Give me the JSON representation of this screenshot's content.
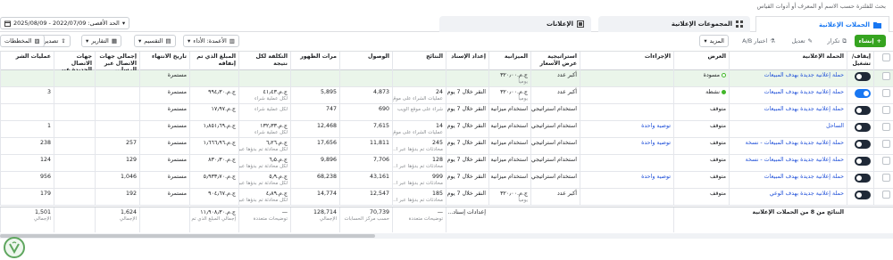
{
  "search": {
    "placeholder": "بحث للفلترة حسب الاسم أو المعرف أو أدوات القياس"
  },
  "tabs": [
    {
      "label": "الحملات الإعلانية",
      "icon": "folder-icon"
    },
    {
      "label": "المجموعات الإعلانية",
      "icon": "grid-icon"
    },
    {
      "label": "الإعلانات",
      "icon": "ad-icon"
    }
  ],
  "date_range": {
    "label": "الحد الأقصى: 2022/07/09 - 2025/08/09"
  },
  "toolbar": {
    "create": "إنشاء",
    "duplicate": "تكرار",
    "edit": "تعديل",
    "ab_test": "اختبار A/B",
    "more": "المزيد",
    "columns": "الأعمدة: الأداء",
    "breakdown": "التقسيم",
    "reports": "التقارير",
    "export": "تصدير",
    "charts": "المخططات"
  },
  "headers": {
    "offon": "إيقاف/تشغيل",
    "campaign": "الحملة الإعلانية",
    "delivery": "العرض",
    "actions": "الإجراءات",
    "bid_strategy": "استراتيجية عرض الأسعار",
    "budget": "الميزانية",
    "attribution": "إعداد الإسناد",
    "results": "النتائج",
    "reach": "الوصول",
    "impressions": "مرات الظهور",
    "cost_per_result": "التكلفة لكل نتيجة",
    "amount_spent": "المبلغ الذي تم إنفاقه",
    "ends": "تاريخ الانتهاء",
    "total_contacts": "إجمالي جهات الاتصال عبر الرسا...",
    "new_contacts": "جهات الاتصال الجديدة عبر الرسا...",
    "purchases": "عمليات الشر"
  },
  "rows": [
    {
      "toggle": "off",
      "name": "حملة إعلانية جديدة بهدف المبيعات",
      "delivery": "مسودة",
      "dot": "outline",
      "action": "",
      "bid": "أكبر عدد",
      "budget": "ج.م.٣٢٠٫٠٠",
      "budget_sub": "يومياً",
      "attribution": "",
      "attribution_sub": "",
      "results": "",
      "results_sub": "",
      "reach": "",
      "impressions": "",
      "cpr": "",
      "cpr_sub": "",
      "spent": "",
      "ends": "مستمرة",
      "total_contacts": "",
      "new_contacts": "",
      "purchases": ""
    },
    {
      "toggle": "on",
      "name": "حملة إعلانية جديدة بهدف المبيعات",
      "delivery": "نشطة",
      "dot": "green",
      "action": "",
      "bid": "أكبر عدد",
      "budget": "ج.م.٣٢٠٫٠٠",
      "budget_sub": "يومياً",
      "attribution": "النقر خلال 7 يوم...",
      "attribution_sub": "",
      "results": "24",
      "results_sub": "عمليات الشراء على موقع",
      "reach": "4,873",
      "impressions": "5,895",
      "cpr": "ج.م.٤١٫٤٣",
      "cpr_sub": "لكل عملية شراء",
      "spent": "ج.م.٩٩٤٫٣٠",
      "ends": "مستمرة",
      "total_contacts": "",
      "new_contacts": "",
      "purchases": "3"
    },
    {
      "toggle": "off",
      "name": "حملة إعلانية جديدة بهدف المبيعات",
      "delivery": "متوقف",
      "dot": "",
      "action": "",
      "bid": "استخدام استراتيجي...",
      "budget": "استخدام ميزانية ال...",
      "budget_sub": "",
      "attribution": "النقر خلال 7 يوم...",
      "attribution_sub": "",
      "results": "",
      "results_sub": "شراء على موقع الويب",
      "reach": "690",
      "impressions": "747",
      "cpr": "",
      "cpr_sub": "لكل عملية شراء",
      "spent": "ج.م.١٧٫٩٧",
      "ends": "مستمرة",
      "total_contacts": "",
      "new_contacts": "",
      "purchases": ""
    },
    {
      "toggle": "off",
      "name": "الساحل",
      "delivery": "متوقف",
      "dot": "",
      "action": "توصية واحدة",
      "bid": "استخدام استراتيجي...",
      "budget": "استخدام ميزانية ال...",
      "budget_sub": "",
      "attribution": "النقر خلال 7 يوم...",
      "attribution_sub": "",
      "results": "14",
      "results_sub": "عمليات الشراء على موقع",
      "reach": "7,615",
      "impressions": "12,468",
      "cpr": "ج.م.١٣٢٫٣٣",
      "cpr_sub": "لكل عملية شراء",
      "spent": "ج.م.١٫٨٥١٫٦٩",
      "ends": "مستمرة",
      "total_contacts": "",
      "new_contacts": "",
      "purchases": "1"
    },
    {
      "toggle": "off",
      "name": "حملة إعلانية جديدة بهدف المبيعات - نسخة",
      "delivery": "متوقف",
      "dot": "",
      "action": "توصية واحدة",
      "bid": "استخدام استراتيجي...",
      "budget": "استخدام ميزانية ال...",
      "budget_sub": "",
      "attribution": "النقر خلال 7 يوم...",
      "attribution_sub": "",
      "results": "245",
      "results_sub": "محادثات تم بدؤها عبر ا...",
      "reach": "11,811",
      "impressions": "17,656",
      "cpr": "ج.م.٦٫٢٦",
      "cpr_sub": "لكل محادثة تم بدؤها عبر",
      "spent": "ج.م.١٫٦٦٦٫٩٦",
      "ends": "مستمرة",
      "total_contacts": "257",
      "new_contacts": "",
      "purchases": "238"
    },
    {
      "toggle": "off",
      "name": "حملة إعلانية جديدة بهدف المبيعات - نسخة",
      "delivery": "متوقف",
      "dot": "",
      "action": "",
      "bid": "استخدام استراتيجي...",
      "budget": "استخدام ميزانية ال...",
      "budget_sub": "",
      "attribution": "النقر خلال 7 يوم...",
      "attribution_sub": "",
      "results": "128",
      "results_sub": "محادثات تم بدؤها عبر ا...",
      "reach": "7,706",
      "impressions": "9,896",
      "cpr": "ج.م.٦٫٥",
      "cpr_sub": "لكل محادثة تم بدؤها عبر",
      "spent": "ج.م.٨٣٠٫٣٠",
      "ends": "مستمرة",
      "total_contacts": "129",
      "new_contacts": "",
      "purchases": "124"
    },
    {
      "toggle": "off",
      "name": "حملة إعلانية جديدة بهدف المبيعات",
      "delivery": "متوقف",
      "dot": "",
      "action": "توصية واحدة",
      "bid": "استخدام استراتيجي...",
      "budget": "استخدام ميزانية ال...",
      "budget_sub": "",
      "attribution": "النقر خلال 7 يوم...",
      "attribution_sub": "",
      "results": "999",
      "results_sub": "محادثات تم بدؤها عبر ا...",
      "reach": "43,161",
      "impressions": "68,238",
      "cpr": "ج.م.٥٫٩",
      "cpr_sub": "لكل محادثة تم بدؤها عبر",
      "spent": "ج.م.٥٫٩٣٣٫٧٠",
      "ends": "مستمرة",
      "total_contacts": "1,046",
      "new_contacts": "",
      "purchases": "956"
    },
    {
      "toggle": "off",
      "name": "حملة إعلانية جديدة بهدف الوعي",
      "delivery": "متوقف",
      "dot": "",
      "action": "",
      "bid": "أكبر عدد",
      "budget": "ج.م.٣٢٠٫٠٠",
      "budget_sub": "يومياً",
      "attribution": "النقر خلال 7 يوم...",
      "attribution_sub": "",
      "results": "185",
      "results_sub": "محادثات تم بدؤها عبر ا...",
      "reach": "12,547",
      "impressions": "14,774",
      "cpr": "ج.م.٤٫٨٩",
      "cpr_sub": "لكل محادثة تم بدؤها عبر",
      "spent": "ج.م.٩٠٤٫٦٧",
      "ends": "مستمرة",
      "total_contacts": "192",
      "new_contacts": "",
      "purchases": "179"
    }
  ],
  "footer": {
    "label": "النتائج من 8 من الحملات الإعلانية",
    "attribution": "إعدادات إسناد...",
    "results_sub": "توضيحات متعددة",
    "reach": "70,739",
    "reach_sub": "حسب مركز الحسابات",
    "impressions": "128,714",
    "impressions_sub": "الإجمالي",
    "cpr_sub": "توضيحات متعددة",
    "spent": "ج.م.١١٫٩٠٨٫٣٠",
    "spent_sub": "إجمالي المبلغ الذي تم",
    "total_contacts": "1,624",
    "total_contacts_sub": "الإجمالي",
    "purchases": "1,501",
    "purchases_sub": "الإجمالي"
  }
}
